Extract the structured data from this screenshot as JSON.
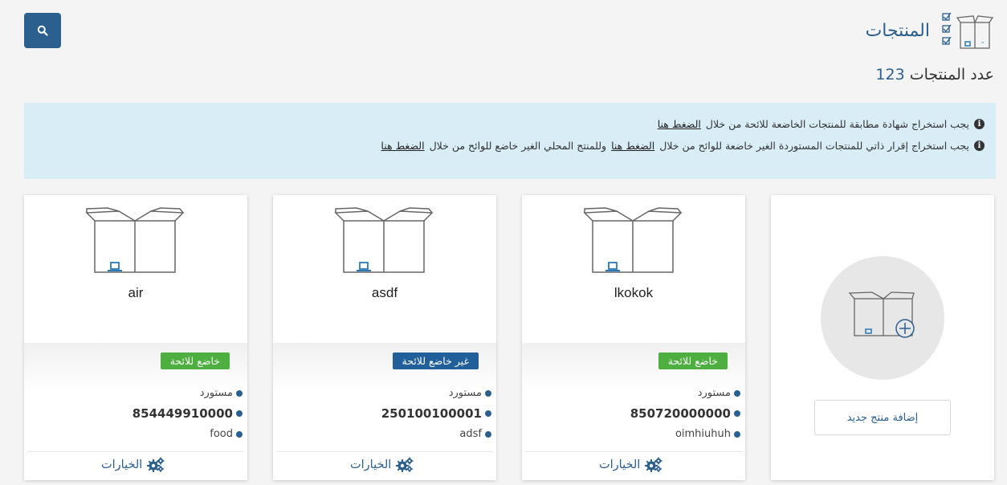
{
  "header": {
    "title": "المنتجات",
    "count_label": "عدد المنتجات",
    "count_value": "123"
  },
  "info": {
    "line1_text": "يجب استخراج شهادة مطابقة للمنتجات الخاضعة للائحة من خلال",
    "line1_link": "الضغط هنا",
    "line2_text_a": "يجب استخراج إقرار ذاتي للمنتجات المستوردة الغير خاضعة للوائح من خلال",
    "line2_link_a": "الضغط هنا",
    "line2_text_b": "وللمنتج المحلي الغير خاضع للوائح من خلال",
    "line2_link_b": "الضغط هنا"
  },
  "add_card": {
    "button_label": "إضافة منتج جديد"
  },
  "products": [
    {
      "name": "lkokok",
      "badge": "خاضع للائحة",
      "badge_color": "#4caf3f",
      "origin": "مستورد",
      "code": "850720000000",
      "category": "oimhiuhuh",
      "options_label": "الخيارات"
    },
    {
      "name": "asdf",
      "badge": "غير خاضع للائحة",
      "badge_color": "#205f99",
      "origin": "مستورد",
      "code": "250100100001",
      "category": "adsf",
      "options_label": "الخيارات"
    },
    {
      "name": "air",
      "badge": "خاضع للائحة",
      "badge_color": "#4caf3f",
      "origin": "مستورد",
      "code": "854449910000",
      "category": "food",
      "options_label": "الخيارات"
    }
  ],
  "colors": {
    "primary": "#2b5f8e",
    "info_bg": "#d9edf7"
  },
  "icons": {
    "search": "search-icon",
    "options": "gears-icon",
    "info": "info-circle-icon"
  }
}
